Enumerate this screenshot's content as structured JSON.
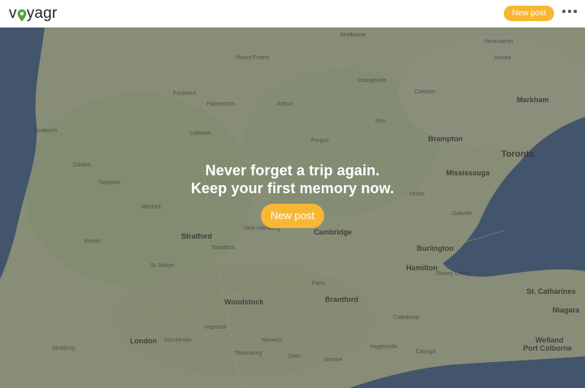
{
  "header": {
    "logo_text_a": "v",
    "logo_text_b": "yagr",
    "new_post_label": "New post",
    "more_icon": "more-horizontal-icon",
    "accent": "#f7b733"
  },
  "hero": {
    "line1": "Never forget a trip again.",
    "line2": "Keep your first memory now.",
    "button_label": "New post"
  },
  "map": {
    "places": [
      {
        "name": "Shelburne"
      },
      {
        "name": "Mount Forest"
      },
      {
        "name": "Orangeville"
      },
      {
        "name": "Caledon"
      },
      {
        "name": "Newmarket"
      },
      {
        "name": "Aurora"
      },
      {
        "name": "Markham"
      },
      {
        "name": "Fordwich"
      },
      {
        "name": "Palmerston"
      },
      {
        "name": "Arthur"
      },
      {
        "name": "Goderich"
      },
      {
        "name": "Listowel"
      },
      {
        "name": "Fergus"
      },
      {
        "name": "Erin"
      },
      {
        "name": "Brampton"
      },
      {
        "name": "Toronto"
      },
      {
        "name": "Clinton"
      },
      {
        "name": "Seaforth"
      },
      {
        "name": "Mississauga"
      },
      {
        "name": "Milton"
      },
      {
        "name": "Mitchell"
      },
      {
        "name": "Stratford"
      },
      {
        "name": "New Hamburg"
      },
      {
        "name": "Cambridge"
      },
      {
        "name": "Oakville"
      },
      {
        "name": "Exeter"
      },
      {
        "name": "Tavistock"
      },
      {
        "name": "Burlington"
      },
      {
        "name": "Hamilton"
      },
      {
        "name": "Stoney Creek"
      },
      {
        "name": "St. Marys"
      },
      {
        "name": "Paris"
      },
      {
        "name": "St. Catharines"
      },
      {
        "name": "Woodstock"
      },
      {
        "name": "Brantford"
      },
      {
        "name": "Niagara"
      },
      {
        "name": "Ingersoll"
      },
      {
        "name": "Caledonia"
      },
      {
        "name": "Strathroy"
      },
      {
        "name": "London"
      },
      {
        "name": "Dorchester"
      },
      {
        "name": "Norwich"
      },
      {
        "name": "Hagersville"
      },
      {
        "name": "Cayuga"
      },
      {
        "name": "Welland"
      },
      {
        "name": "Port Colborne"
      },
      {
        "name": "Tillsonburg"
      },
      {
        "name": "Delhi"
      },
      {
        "name": "Simcoe"
      }
    ]
  }
}
